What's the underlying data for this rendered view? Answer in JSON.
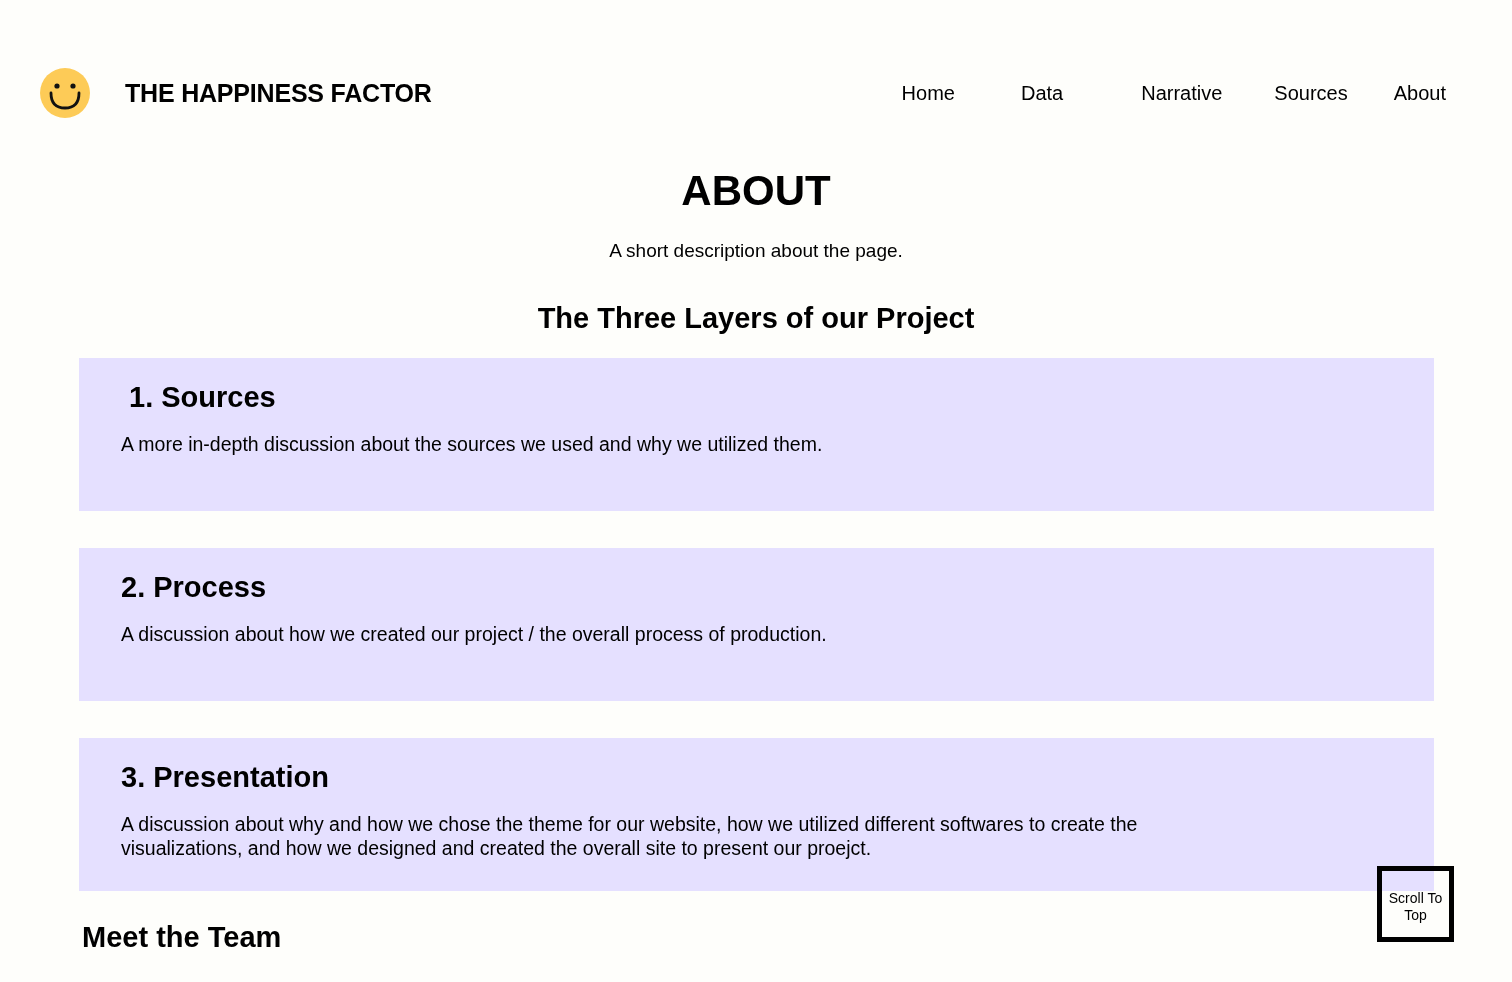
{
  "header": {
    "site_title": "THE HAPPINESS FACTOR",
    "nav": [
      {
        "label": "Home"
      },
      {
        "label": "Data"
      },
      {
        "label": "Narrative"
      },
      {
        "label": "Sources"
      },
      {
        "label": "About"
      }
    ]
  },
  "page": {
    "title": "ABOUT",
    "description": "A short description about the page.",
    "section_title": "The Three Layers of our Project"
  },
  "layers": [
    {
      "heading": "1. Sources",
      "text": "A more in-depth discussion about the sources we used and why we utilized them."
    },
    {
      "heading": "2. Process",
      "text": "A discussion about how we created our project / the overall process of production."
    },
    {
      "heading": "3. Presentation",
      "text": "A discussion about why and how we chose the theme for our website, how we utilized different softwares to create the visualizations, and how we designed and created the overall site to present our proejct."
    }
  ],
  "team_title": "Meet the Team",
  "scroll_button": "Scroll To Top"
}
